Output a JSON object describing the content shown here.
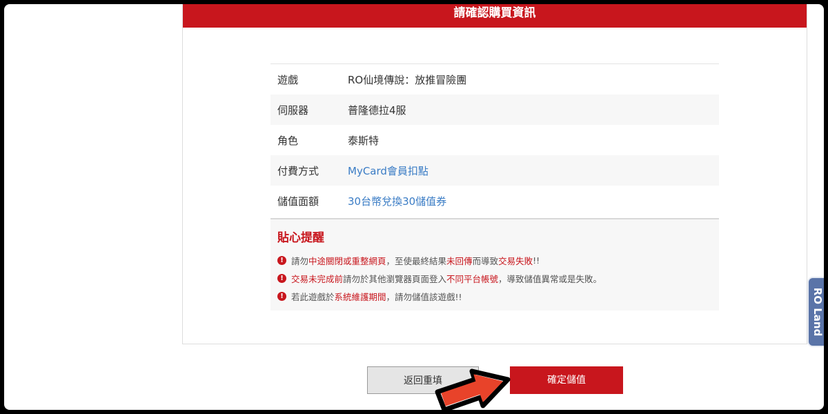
{
  "header": {
    "title": "請確認購買資訊"
  },
  "info_rows": [
    {
      "label": "遊戲",
      "value": "RO仙境傳說：放推冒險團"
    },
    {
      "label": "伺服器",
      "value": "普隆德拉4服"
    },
    {
      "label": "角色",
      "value": "泰斯特"
    },
    {
      "label": "付費方式",
      "value": "MyCard會員扣點"
    },
    {
      "label": "儲值面額",
      "value": "30台幣兌換30儲值券"
    }
  ],
  "notice": {
    "title": "貼心提醒",
    "icon": "exclamation-icon",
    "line1": [
      "請勿",
      "中途關閉或重整網頁",
      "，至使最終結果",
      "未回傳",
      "而導致",
      "交易失敗",
      "!!"
    ],
    "line2": [
      "交易未完成前",
      "請勿於其他瀏覽器頁面登入",
      "不同平台帳號",
      "，導致儲值異常或是失敗。"
    ],
    "line3": [
      "若此遊戲於",
      "系統維護期間",
      "，請勿儲值該遊戲!!"
    ]
  },
  "buttons": {
    "back": "返回重填",
    "confirm": "確定儲值"
  },
  "side_tab": {
    "label": "RO Land"
  },
  "colors": {
    "accent": "#c8161d",
    "link": "#3a7cc5",
    "side_tab": "#5a74a8"
  }
}
